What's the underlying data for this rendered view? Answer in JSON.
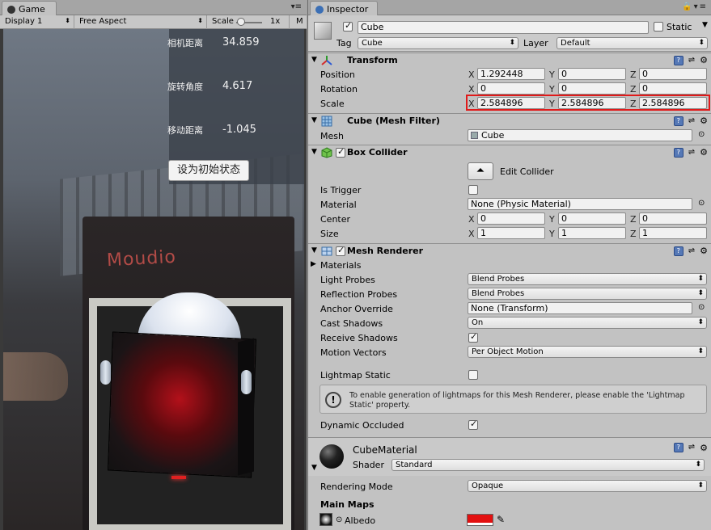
{
  "game": {
    "tab_label": "Game",
    "display": "Display 1",
    "aspect": "Free Aspect",
    "scale_label": "Scale",
    "scale_value": "1x",
    "maximize_label": "M",
    "info": {
      "rows": [
        {
          "label": "相机距离",
          "value": "34.859"
        },
        {
          "label": "旋转角度",
          "value": "4.617"
        },
        {
          "label": "移动距离",
          "value": "-1.045"
        }
      ],
      "reset_button": "设为初始状态"
    },
    "scene_brand": "Moudio"
  },
  "inspector": {
    "tab_label": "Inspector",
    "object": {
      "name": "Cube",
      "active": true,
      "static_label": "Static",
      "tag_label": "Tag",
      "tag_value": "Cube",
      "layer_label": "Layer",
      "layer_value": "Default"
    },
    "transform": {
      "title": "Transform",
      "position": {
        "label": "Position",
        "x": "1.292448",
        "y": "0",
        "z": "0"
      },
      "rotation": {
        "label": "Rotation",
        "x": "0",
        "y": "0",
        "z": "0"
      },
      "scale": {
        "label": "Scale",
        "x": "2.584896",
        "y": "2.584896",
        "z": "2.584896"
      }
    },
    "mesh_filter": {
      "title": "Cube (Mesh Filter)",
      "mesh_label": "Mesh",
      "mesh_value": "Cube"
    },
    "box_collider": {
      "title": "Box Collider",
      "enabled": true,
      "edit_label": "Edit Collider",
      "is_trigger_label": "Is Trigger",
      "is_trigger": false,
      "material_label": "Material",
      "material_value": "None (Physic Material)",
      "center": {
        "label": "Center",
        "x": "0",
        "y": "0",
        "z": "0"
      },
      "size": {
        "label": "Size",
        "x": "1",
        "y": "1",
        "z": "1"
      }
    },
    "mesh_renderer": {
      "title": "Mesh Renderer",
      "enabled": true,
      "materials_label": "Materials",
      "light_probes_label": "Light Probes",
      "light_probes_value": "Blend Probes",
      "reflection_probes_label": "Reflection Probes",
      "reflection_probes_value": "Blend Probes",
      "anchor_override_label": "Anchor Override",
      "anchor_override_value": "None (Transform)",
      "cast_shadows_label": "Cast Shadows",
      "cast_shadows_value": "On",
      "receive_shadows_label": "Receive Shadows",
      "receive_shadows": true,
      "motion_vectors_label": "Motion Vectors",
      "motion_vectors_value": "Per Object Motion",
      "lightmap_static_label": "Lightmap Static",
      "lightmap_static": false,
      "help_text": "To enable generation of lightmaps for this Mesh Renderer, please enable the 'Lightmap Static' property.",
      "dynamic_occluded_label": "Dynamic Occluded",
      "dynamic_occluded": true
    },
    "material": {
      "name": "CubeMaterial",
      "shader_label": "Shader",
      "shader_value": "Standard",
      "rendering_mode_label": "Rendering Mode",
      "rendering_mode_value": "Opaque",
      "main_maps_label": "Main Maps",
      "albedo_label": "Albedo",
      "albedo_color": "#e21010"
    },
    "axis_labels": {
      "x": "X",
      "y": "Y",
      "z": "Z"
    }
  }
}
